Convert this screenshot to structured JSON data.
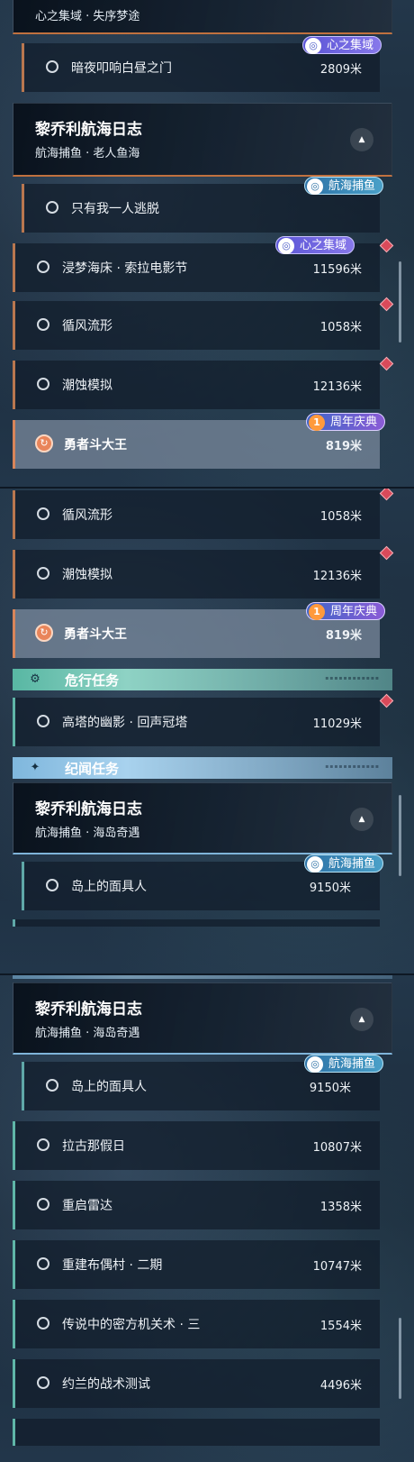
{
  "screen1": {
    "group_partial": {
      "subtitle": "心之集域 · 失序梦途"
    },
    "task_dark_door": {
      "name": "暗夜叩响白昼之门",
      "distance": "2809米",
      "badge": "心之集域"
    },
    "group_lijoly": {
      "title": "黎乔利航海日志",
      "subtitle": "航海捕鱼 · 老人鱼海"
    },
    "task_alone": {
      "name": "只有我一人逃脱",
      "badge": "航海捕鱼"
    },
    "task_dream_beach": {
      "name": "浸梦海床 · 索拉电影节",
      "distance": "11596米",
      "badge": "心之集域"
    },
    "task_wind": {
      "name": "循风流形",
      "distance": "1058米"
    },
    "task_tide": {
      "name": "潮蚀模拟",
      "distance": "12136米"
    },
    "task_brave": {
      "name": "勇者斗大王",
      "distance": "819米",
      "badge": "周年庆典"
    }
  },
  "screen2": {
    "task_wind": {
      "name": "循风流形",
      "distance": "1058米"
    },
    "task_tide": {
      "name": "潮蚀模拟",
      "distance": "12136米"
    },
    "task_brave": {
      "name": "勇者斗大王",
      "distance": "819米",
      "badge": "周年庆典"
    },
    "section_danger": {
      "label": "危行任务"
    },
    "task_tower": {
      "name": "高塔的幽影 · 回声冠塔",
      "distance": "11029米"
    },
    "section_lore": {
      "label": "纪闻任务"
    },
    "group_lijoly": {
      "title": "黎乔利航海日志",
      "subtitle": "航海捕鱼 · 海岛奇遇"
    },
    "task_mask": {
      "name": "岛上的面具人",
      "distance": "9150米",
      "badge": "航海捕鱼"
    }
  },
  "screen3": {
    "group_lijoly": {
      "title": "黎乔利航海日志",
      "subtitle": "航海捕鱼 · 海岛奇遇"
    },
    "task_mask": {
      "name": "岛上的面具人",
      "distance": "9150米",
      "badge": "航海捕鱼"
    },
    "task_lagu": {
      "name": "拉古那假日",
      "distance": "10807米"
    },
    "task_radar": {
      "name": "重启雷达",
      "distance": "1358米"
    },
    "task_rebuild": {
      "name": "重建布偶村 · 二期",
      "distance": "10747米"
    },
    "task_secret": {
      "name": "传说中的密方机关术 · 三",
      "distance": "1554米"
    },
    "task_joran": {
      "name": "约兰的战术测试",
      "distance": "4496米"
    }
  },
  "anniversary_badge_number": "1",
  "colors": {
    "orange_accent": "#c0713f",
    "teal_accent": "#5fb6a8",
    "blue_accent": "#7fb4d9",
    "marker_red": "#d94a5a",
    "badge_purple": "#5b55d6",
    "badge_cyan": "#2d72a6"
  },
  "icons": {
    "incomplete_task": "radio-circle-icon",
    "special_task": "refresh-swirl-icon",
    "collapse": "triangle-up-icon",
    "tracked_marker": "red-diamond-icon",
    "danger_section": "gear-eye-icon",
    "lore_section": "sparkle-star-icon"
  }
}
